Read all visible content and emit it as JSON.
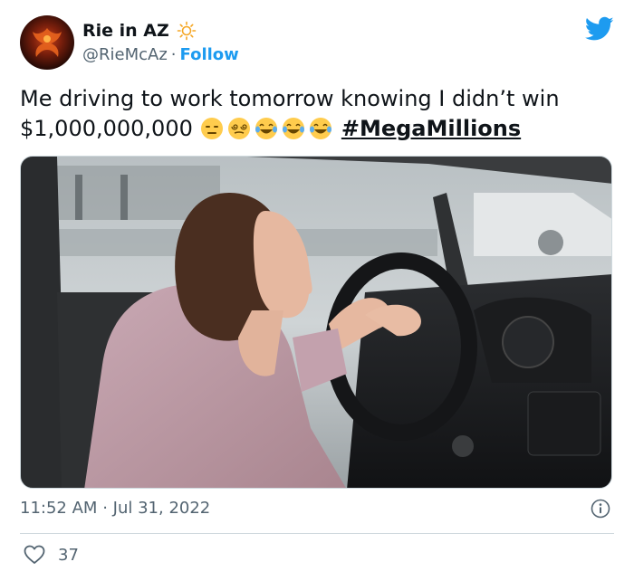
{
  "author": {
    "display_name": "Rie in AZ",
    "handle": "@RieMcAz",
    "separator": "·",
    "follow_label": "Follow"
  },
  "tweet": {
    "text_line1": "Me driving to work tomorrow knowing I didn’t win",
    "text_line2": "$1,000,000,000",
    "emojis": [
      "expressionless-face",
      "face-with-spiral-eyes",
      "face-with-tears-of-joy",
      "face-with-tears-of-joy",
      "face-with-tears-of-joy"
    ],
    "hashtag": "#MegaMillions"
  },
  "meta": {
    "time": "11:52 AM",
    "separator": "·",
    "date": "Jul 31, 2022"
  },
  "likes": {
    "count": "37"
  },
  "colors": {
    "brand": "#1d9bf0",
    "text": "#0f1419",
    "muted": "#536471",
    "border": "#cfd9de"
  }
}
